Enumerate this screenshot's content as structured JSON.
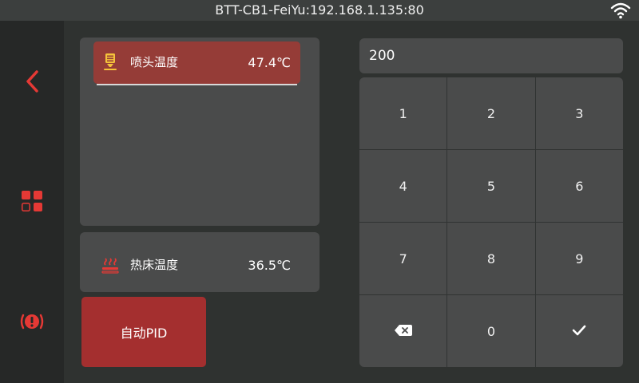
{
  "topbar": {
    "title": "BTT-CB1-FeiYu:192.168.1.135:80",
    "wifi_icon": "wifi-icon"
  },
  "sidebar": {
    "back_icon": "back-arrow-icon",
    "menu_icon": "grid-menu-icon",
    "alert_icon": "emergency-stop-icon"
  },
  "extruder": {
    "label": "喷头温度",
    "value": "47.4℃",
    "icon": "nozzle-icon"
  },
  "bed": {
    "label": "热床温度",
    "value": "36.5℃",
    "icon": "heated-bed-icon"
  },
  "pid_button": {
    "label": "自动PID"
  },
  "input": {
    "value": "200"
  },
  "keypad": {
    "keys": [
      "1",
      "2",
      "3",
      "4",
      "5",
      "6",
      "7",
      "8",
      "9",
      "",
      "0",
      ""
    ],
    "backspace_icon": "backspace-icon",
    "confirm_icon": "checkmark-icon"
  },
  "colors": {
    "accent": "#e53935",
    "active_row": "#953c37",
    "pid_button": "#a42f2f",
    "panel": "#4a4b4b",
    "background": "#2f3230"
  }
}
